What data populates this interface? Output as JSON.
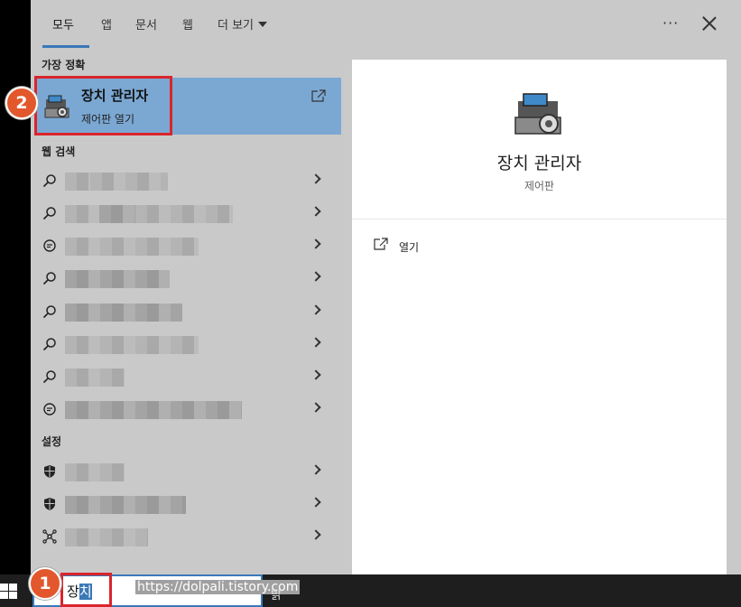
{
  "tabs": [
    {
      "label": "모두"
    },
    {
      "label": "앱"
    },
    {
      "label": "문서"
    },
    {
      "label": "웹"
    },
    {
      "label": "더 보기"
    }
  ],
  "header": {
    "more_label": "···"
  },
  "sections": {
    "best_match": "가장 정확",
    "web_search": "웹 검색",
    "settings": "설정"
  },
  "best_match": {
    "title": "장치 관리자",
    "subtitle": "제어판 열기",
    "icon": "device-manager-icon"
  },
  "preview": {
    "title": "장치 관리자",
    "subtitle": "제어판",
    "action_label": "열기"
  },
  "badges": {
    "one": "1",
    "two": "2"
  },
  "search": {
    "text_plain": "장",
    "text_selected": "치",
    "watermark": "https://dolpali.tistory.com",
    "trailing_glyph": "밝"
  },
  "colors": {
    "accent": "#3a78b8",
    "best_match_bg": "#7ba8d3",
    "highlight_red": "#d9252b",
    "badge_orange": "#e2582c"
  }
}
